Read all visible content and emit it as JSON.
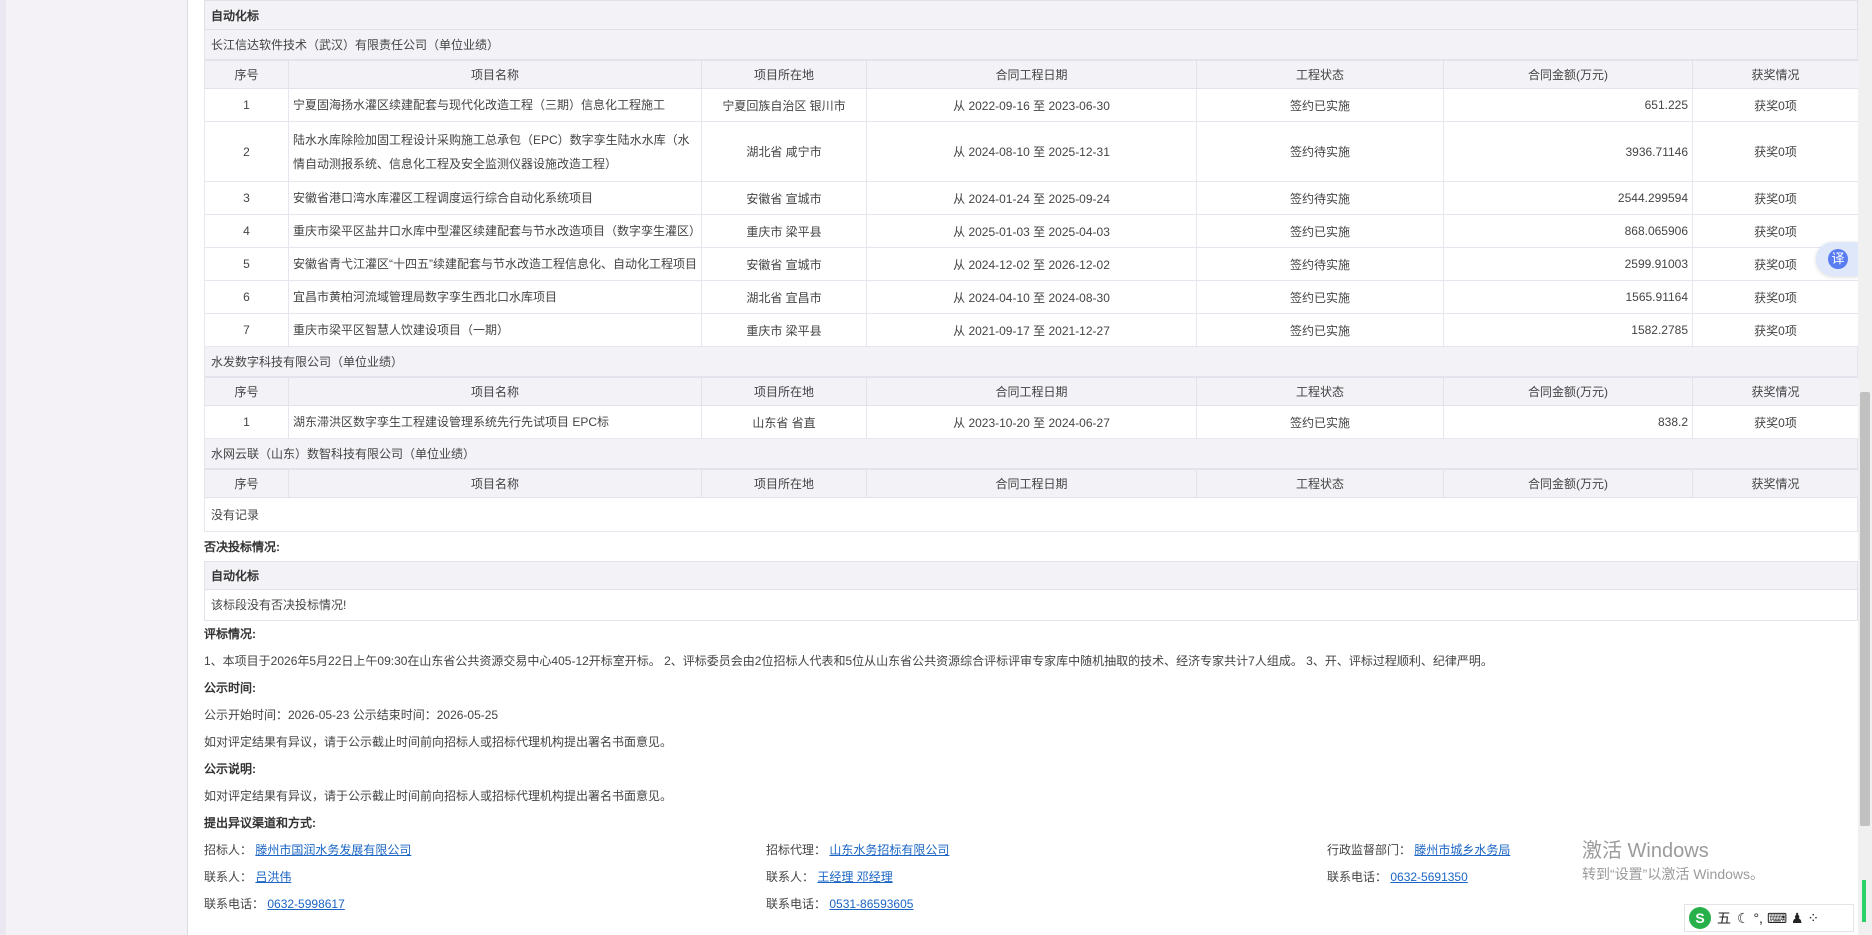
{
  "section_title": "自动化标",
  "columns": [
    "序号",
    "项目名称",
    "项目所在地",
    "合同工程日期",
    "工程状态",
    "合同金额(万元)",
    "获奖情况"
  ],
  "companies": [
    {
      "name": "长江信达软件技术（武汉）有限责任公司（单位业绩）",
      "rows": [
        {
          "no": "1",
          "name": "宁夏固海扬水灌区续建配套与现代化改造工程（三期）信息化工程施工",
          "loc": "宁夏回族自治区 银川市",
          "date": "从 2022-09-16 至 2023-06-30",
          "status": "签约已实施",
          "amount": "651.225",
          "award": "获奖0项"
        },
        {
          "no": "2",
          "name": "陆水水库除险加固工程设计采购施工总承包（EPC）数字孪生陆水水库（水情自动测报系统、信息化工程及安全监测仪器设施改造工程）",
          "loc": "湖北省 咸宁市",
          "date": "从 2024-08-10 至 2025-12-31",
          "status": "签约待实施",
          "amount": "3936.71146",
          "award": "获奖0项"
        },
        {
          "no": "3",
          "name": "安徽省港口湾水库灌区工程调度运行综合自动化系统项目",
          "loc": "安徽省 宣城市",
          "date": "从 2024-01-24 至 2025-09-24",
          "status": "签约待实施",
          "amount": "2544.299594",
          "award": "获奖0项"
        },
        {
          "no": "4",
          "name": "重庆市梁平区盐井口水库中型灌区续建配套与节水改造项目（数字孪生灌区）",
          "loc": "重庆市 梁平县",
          "date": "从 2025-01-03 至 2025-04-03",
          "status": "签约已实施",
          "amount": "868.065906",
          "award": "获奖0项"
        },
        {
          "no": "5",
          "name": "安徽省青弋江灌区“十四五”续建配套与节水改造工程信息化、自动化工程项目",
          "loc": "安徽省 宣城市",
          "date": "从 2024-12-02 至 2026-12-02",
          "status": "签约待实施",
          "amount": "2599.91003",
          "award": "获奖0项"
        },
        {
          "no": "6",
          "name": "宜昌市黄柏河流域管理局数字孪生西北口水库项目",
          "loc": "湖北省 宜昌市",
          "date": "从 2024-04-10 至 2024-08-30",
          "status": "签约已实施",
          "amount": "1565.91164",
          "award": "获奖0项"
        },
        {
          "no": "7",
          "name": "重庆市梁平区智慧人饮建设项目（一期）",
          "loc": "重庆市 梁平县",
          "date": "从 2021-09-17 至 2021-12-27",
          "status": "签约已实施",
          "amount": "1582.2785",
          "award": "获奖0项"
        }
      ]
    },
    {
      "name": "水发数字科技有限公司（单位业绩）",
      "rows": [
        {
          "no": "1",
          "name": "湖东滞洪区数字孪生工程建设管理系统先行先试项目 EPC标",
          "loc": "山东省 省直",
          "date": "从 2023-10-20 至 2024-06-27",
          "status": "签约已实施",
          "amount": "838.2",
          "award": "获奖0项"
        }
      ]
    },
    {
      "name": "水网云联（山东）数智科技有限公司（单位业绩）",
      "rows": []
    }
  ],
  "no_record": "没有记录",
  "veto": {
    "label": "否决投标情况:",
    "box_title": "自动化标",
    "text": "该标段没有否决投标情况!"
  },
  "evaluation": {
    "label": "评标情况:",
    "text": "1、本项目于2026年5月22日上午09:30在山东省公共资源交易中心405-12开标室开标。 2、评标委员会由2位招标人代表和5位从山东省公共资源综合评标评审专家库中随机抽取的技术、经济专家共计7人组成。 3、开、评标过程顺利、纪律严明。"
  },
  "publicity_time": {
    "label": "公示时间:",
    "text": "公示开始时间：2026-05-23  公示结束时间：2026-05-25",
    "note": "如对评定结果有异议，请于公示截止时间前向招标人或招标代理机构提出署名书面意见。"
  },
  "publicity_note": {
    "label": "公示说明:",
    "text": "如对评定结果有异议，请于公示截止时间前向招标人或招标代理机构提出署名书面意见。"
  },
  "objection": {
    "label": "提出异议渠道和方式:",
    "tenderer_label": "招标人：",
    "tenderer": "滕州市国润水务发展有限公司",
    "agent_label": "招标代理：",
    "agent": "山东水务招标有限公司",
    "regulator_label": "行政监督部门：",
    "regulator": "滕州市城乡水务局",
    "contact1_label": "联系人：",
    "contact1": "吕洪伟",
    "contact2_label": "联系人：",
    "contact2": "王经理 邓经理",
    "phone3_label": "联系电话：",
    "phone3": "0632-5691350",
    "phone1_label": "联系电话：",
    "phone1": "0632-5998617",
    "phone2_label": "联系电话：",
    "phone2": "0531-86593605"
  },
  "watermark": {
    "line1": "激活 Windows",
    "line2": "转到“设置”以激活 Windows。"
  },
  "translate_glyph": "译",
  "ime": {
    "logo": "S",
    "mode": "五",
    "symbols": "☾ °, ⌨ ♟ ⁘"
  }
}
